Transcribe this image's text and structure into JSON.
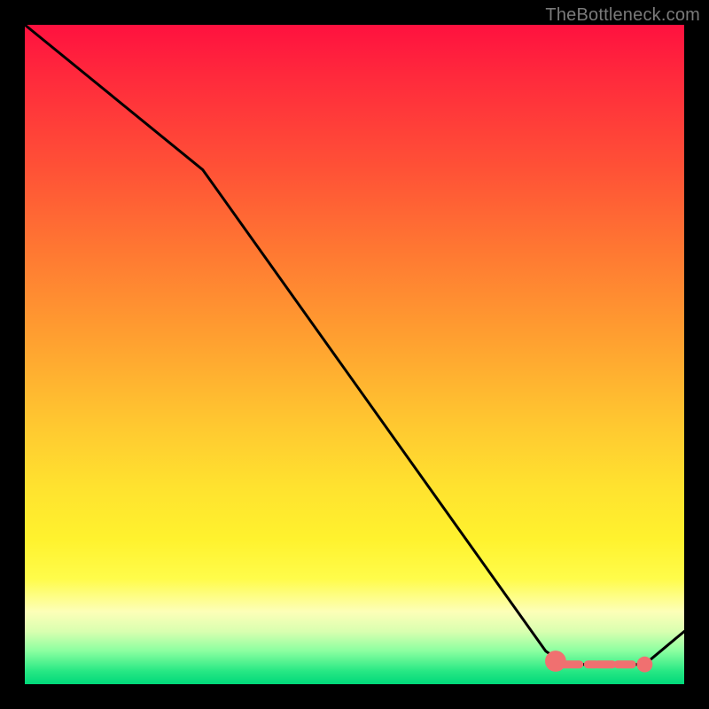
{
  "watermark": "TheBottleneck.com",
  "chart_data": {
    "type": "line",
    "title": "",
    "xlabel": "",
    "ylabel": "",
    "xlim": [
      0,
      100
    ],
    "ylim": [
      0,
      100
    ],
    "grid": false,
    "legend": false,
    "series": [
      {
        "name": "curve",
        "color": "#000000",
        "x": [
          0,
          27,
          79,
          82,
          94,
          100
        ],
        "y": [
          100,
          78,
          5,
          3,
          3,
          8
        ]
      }
    ],
    "markers": [
      {
        "name": "blob-left",
        "color": "#f07070",
        "x": 80.5,
        "y": 3.5,
        "r": 1.6
      },
      {
        "name": "dash-1",
        "color": "#f07070",
        "shape": "dash",
        "x": 83,
        "y": 3,
        "w": 2.2
      },
      {
        "name": "dash-2",
        "color": "#f07070",
        "shape": "dash",
        "x": 86,
        "y": 3,
        "w": 1.2
      },
      {
        "name": "dash-3",
        "color": "#f07070",
        "shape": "dash",
        "x": 88,
        "y": 3,
        "w": 2.2
      },
      {
        "name": "dash-4",
        "color": "#f07070",
        "shape": "dash",
        "x": 91,
        "y": 3,
        "w": 2.2
      },
      {
        "name": "dot-right",
        "color": "#f07070",
        "x": 94,
        "y": 3,
        "r": 1.2
      }
    ]
  }
}
